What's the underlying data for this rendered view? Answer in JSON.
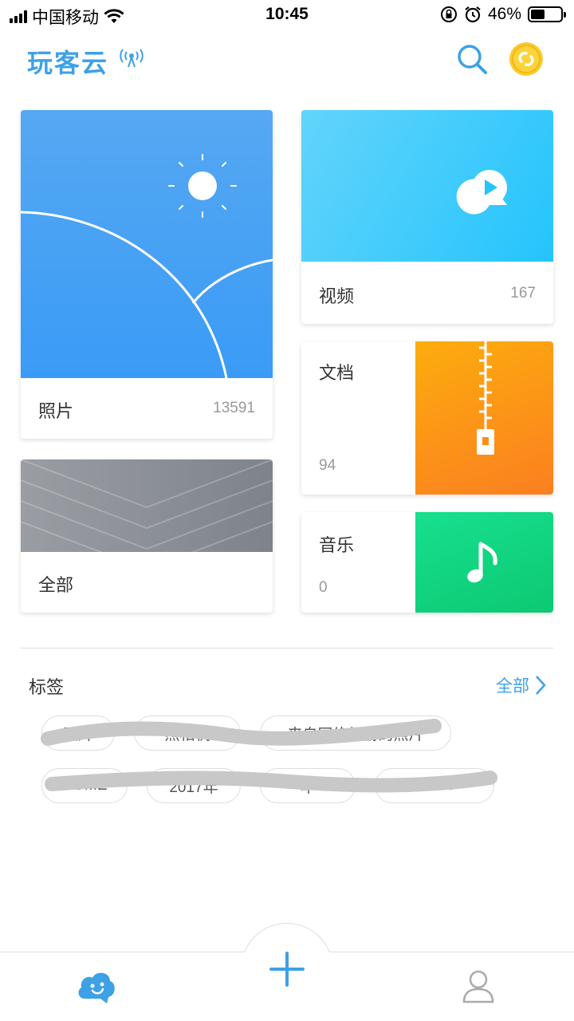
{
  "status_bar": {
    "carrier": "中国移动",
    "time": "10:45",
    "battery": "46%",
    "battery_level": 0.46
  },
  "header": {
    "logo": "玩客云",
    "icons": [
      "signal-tower-icon",
      "search-icon",
      "coin-icon"
    ]
  },
  "cards": {
    "photos": {
      "title": "照片",
      "count": "13591"
    },
    "video": {
      "title": "视频",
      "count": "167"
    },
    "docs": {
      "title": "文档",
      "count": "94"
    },
    "music": {
      "title": "音乐",
      "count": "0"
    },
    "all": {
      "title": "全部"
    }
  },
  "tags": {
    "title": "标签",
    "all_label": "全部",
    "row1": [
      "图片",
      "照相机",
      "来自网络相册的照片"
    ],
    "row2": [
      "HOME",
      "2017年",
      "年",
      "12345"
    ]
  },
  "bottom_nav": {
    "items": [
      "home-icon",
      "add-icon",
      "profile-icon"
    ]
  },
  "colors": {
    "accent": "#3da1e6",
    "photos": "#3a9bf6",
    "video": "#25c4fc",
    "docs": "#fb9a16",
    "music": "#12d580"
  }
}
